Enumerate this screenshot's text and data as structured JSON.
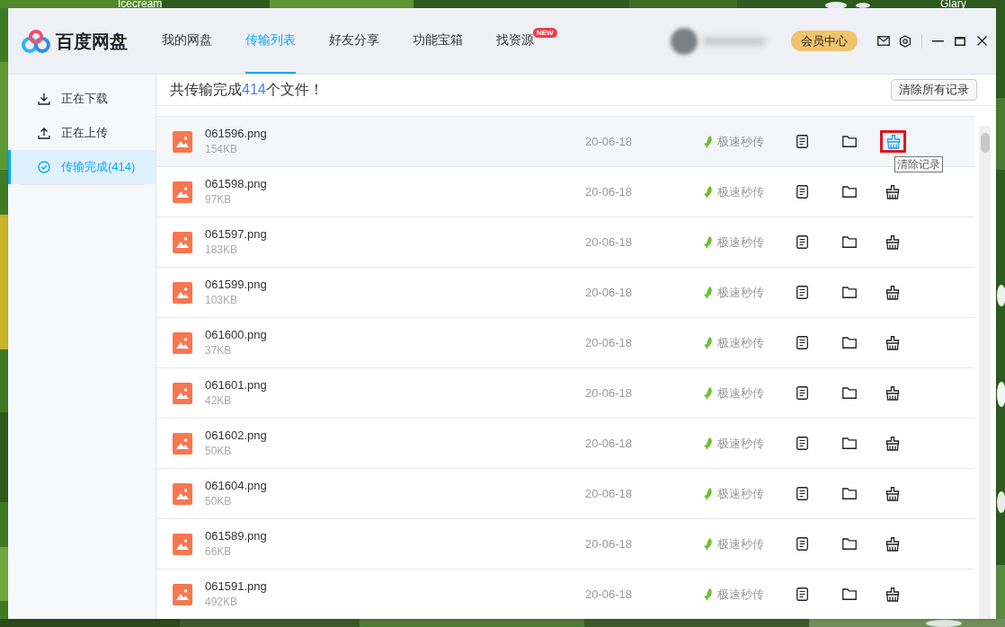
{
  "desktop": {
    "icon_labels": [
      "Icecream",
      "Glary"
    ]
  },
  "app": {
    "name": "百度网盘",
    "tabs": [
      {
        "label": "我的网盘",
        "selected": false
      },
      {
        "label": "传输列表",
        "selected": true
      },
      {
        "label": "好友分享",
        "selected": false
      },
      {
        "label": "功能宝箱",
        "selected": false
      },
      {
        "label": "找资源",
        "selected": false,
        "badge": "NEW"
      }
    ],
    "vip_button": "会员中心"
  },
  "sidebar": {
    "items": [
      {
        "kind": "download",
        "label": "正在下载",
        "selected": false
      },
      {
        "kind": "upload",
        "label": "正在上传",
        "selected": false
      },
      {
        "kind": "done",
        "label": "传输完成(414)",
        "selected": true
      }
    ]
  },
  "content": {
    "summary": "共传输完成**414**个文件！",
    "clear_all_button": "清除所有记录",
    "rows": [
      {
        "name": "061596.png",
        "size": "154KB",
        "date": "20-06-18",
        "method": "极速秒传",
        "highlighted": true,
        "tooltip": "清除记录"
      },
      {
        "name": "061598.png",
        "size": "97KB",
        "date": "20-06-18",
        "method": "极速秒传",
        "highlighted": false
      },
      {
        "name": "061597.png",
        "size": "183KB",
        "date": "20-06-18",
        "method": "极速秒传",
        "highlighted": false
      },
      {
        "name": "061599.png",
        "size": "103KB",
        "date": "20-06-18",
        "method": "极速秒传",
        "highlighted": false
      },
      {
        "name": "061600.png",
        "size": "37KB",
        "date": "20-06-18",
        "method": "极速秒传",
        "highlighted": false
      },
      {
        "name": "061601.png",
        "size": "42KB",
        "date": "20-06-18",
        "method": "极速秒传",
        "highlighted": false
      },
      {
        "name": "061602.png",
        "size": "50KB",
        "date": "20-06-18",
        "method": "极速秒传",
        "highlighted": false
      },
      {
        "name": "061604.png",
        "size": "50KB",
        "date": "20-06-18",
        "method": "极速秒传",
        "highlighted": false
      },
      {
        "name": "061589.png",
        "size": "66KB",
        "date": "20-06-18",
        "method": "极速秒传",
        "highlighted": false
      },
      {
        "name": "061591.png",
        "size": "492KB",
        "date": "20-06-18",
        "method": "极速秒传",
        "highlighted": false
      }
    ]
  }
}
